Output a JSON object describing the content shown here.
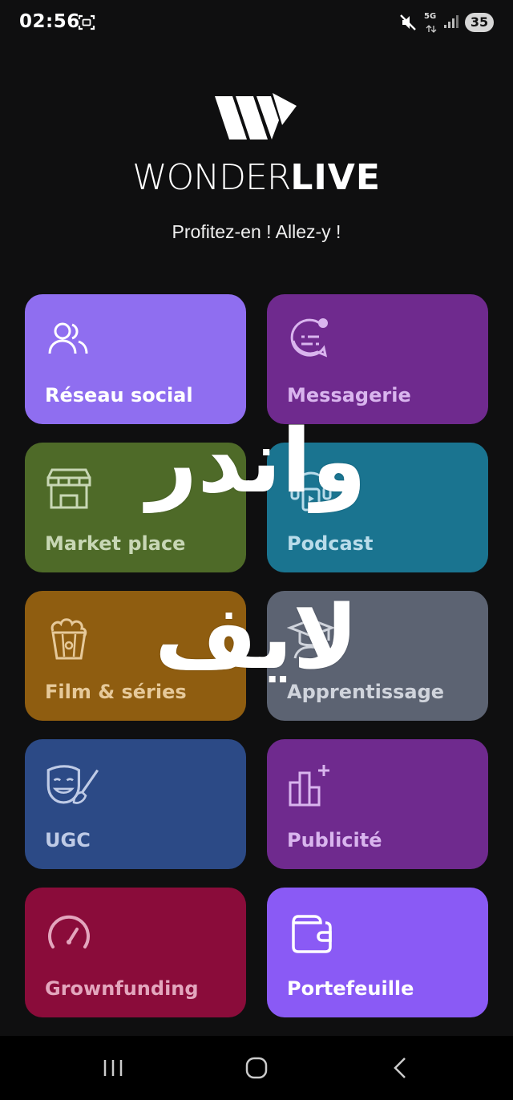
{
  "status_bar": {
    "time": "02:56",
    "network": "5G",
    "battery": "35",
    "icons": [
      "screenshot-icon",
      "mute-icon",
      "signal-icon",
      "battery-icon"
    ]
  },
  "brand": {
    "name_thin": "WONDER",
    "name_bold": "LIVE",
    "tagline": "Profitez-en ! Allez-y !"
  },
  "tiles": [
    {
      "label": "Réseau social",
      "icon": "users-icon",
      "color": "#8f6ef0",
      "text_color": "#ffffff"
    },
    {
      "label": "Messagerie",
      "icon": "chat-icon",
      "color": "#6f2a8e",
      "text_color": "#d9b5ee"
    },
    {
      "label": "Market place",
      "icon": "store-icon",
      "color": "#4e6a28",
      "text_color": "#c8d7b5"
    },
    {
      "label": "Podcast",
      "icon": "podcast-icon",
      "color": "#1a7490",
      "text_color": "#b9dcea"
    },
    {
      "label": "Film & séries",
      "icon": "popcorn-icon",
      "color": "#8f5d10",
      "text_color": "#e6c99a"
    },
    {
      "label": "Apprentissage",
      "icon": "graduation-icon",
      "color": "#5c6372",
      "text_color": "#d0d4dc"
    },
    {
      "label": "UGC",
      "icon": "theater-mask-icon",
      "color": "#2c4a86",
      "text_color": "#bfcbe6"
    },
    {
      "label": "Publicité",
      "icon": "chart-plus-icon",
      "color": "#6f2a8e",
      "text_color": "#d9b5ee"
    },
    {
      "label": "Grownfunding",
      "icon": "gauge-icon",
      "color": "#8a0c3a",
      "text_color": "#e3a6bd"
    },
    {
      "label": "Portefeuille",
      "icon": "wallet-icon",
      "color": "#8a5af5",
      "text_color": "#ffffff"
    }
  ],
  "overlay_text": {
    "line1": "واندر",
    "line2": "لايف"
  },
  "nav": {
    "recents": "recents-icon",
    "home": "home-icon",
    "back": "back-icon"
  }
}
